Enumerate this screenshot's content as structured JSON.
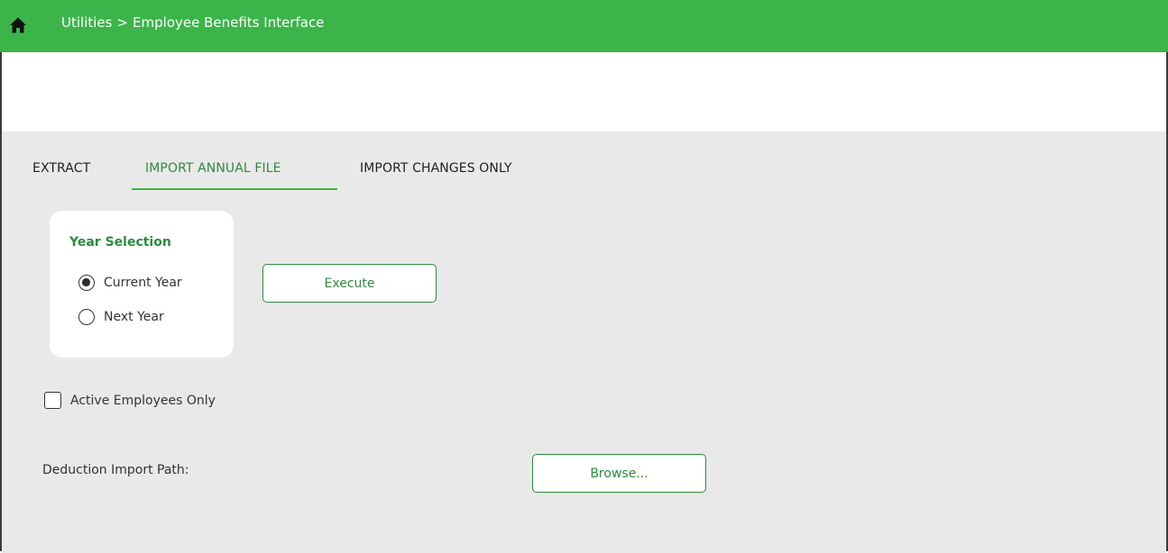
{
  "header": {
    "home_icon": "home-icon",
    "breadcrumb": [
      "Utilities",
      "Employee Benefits Interface"
    ],
    "breadcrumb_separator": ">",
    "accent_color": "#3bb54a"
  },
  "tabs": [
    {
      "label": "EXTRACT",
      "active": false
    },
    {
      "label": "IMPORT ANNUAL FILE",
      "active": true
    },
    {
      "label": "IMPORT CHANGES ONLY",
      "active": false
    }
  ],
  "year_selection": {
    "title": "Year Selection",
    "options": [
      {
        "label": "Current Year",
        "selected": true
      },
      {
        "label": "Next Year",
        "selected": false
      }
    ]
  },
  "execute_label": "Execute",
  "active_employees": {
    "label": "Active Employees Only",
    "checked": false
  },
  "deduction_import": {
    "label": "Deduction Import Path:",
    "browse_label": "Browse..."
  }
}
